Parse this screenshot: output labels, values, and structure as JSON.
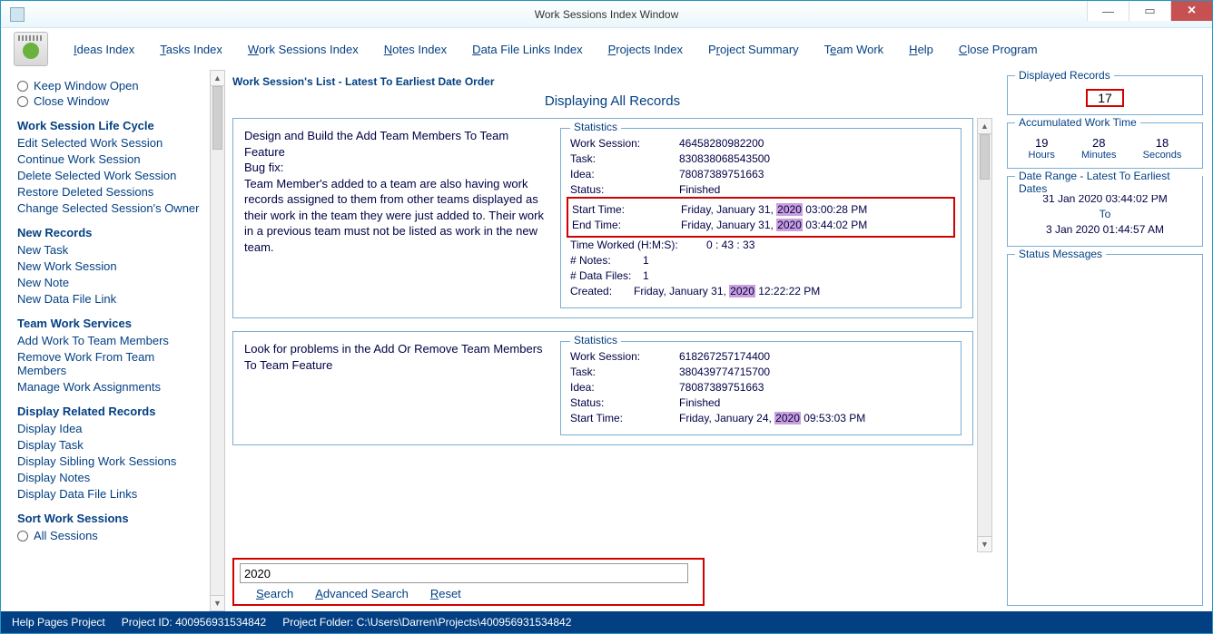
{
  "window": {
    "title": "Work Sessions Index Window"
  },
  "menu": {
    "ideas": "Ideas Index",
    "tasks": "Tasks Index",
    "work": "Work Sessions Index",
    "notes": "Notes Index",
    "datafiles": "Data File Links Index",
    "projects": "Projects Index",
    "summary": "Project Summary",
    "team": "Team Work",
    "help": "Help",
    "close": "Close Program"
  },
  "sidebar": {
    "keep_open": "Keep Window Open",
    "close_win": "Close Window",
    "h_lifecycle": "Work Session Life Cycle",
    "edit_sel": "Edit Selected Work Session",
    "continue": "Continue Work Session",
    "delete_sel": "Delete Selected Work Session",
    "restore": "Restore Deleted Sessions",
    "change_owner": "Change Selected Session's Owner",
    "h_new": "New Records",
    "new_task": "New Task",
    "new_ws": "New Work Session",
    "new_note": "New Note",
    "new_dfl": "New Data File Link",
    "h_team": "Team Work Services",
    "add_work": "Add Work To Team Members",
    "remove_work": "Remove Work From Team Members",
    "manage": "Manage Work Assignments",
    "h_related": "Display Related Records",
    "d_idea": "Display Idea",
    "d_task": "Display Task",
    "d_sibling": "Display Sibling Work Sessions",
    "d_notes": "Display Notes",
    "d_dfl": "Display Data File Links",
    "h_sort": "Sort Work Sessions",
    "all_sessions": "All Sessions"
  },
  "list": {
    "header": "Work Session's List - Latest To Earliest Date Order",
    "displaying": "Displaying All Records",
    "r1": {
      "desc": "Design and Build the Add Team Members To Team Feature\nBug fix:\nTeam Member's added to a team are also having work records assigned to them from other teams displayed as their work in the team they were just added to. Their work in a previous team must not be listed as work in the new team.",
      "stats_title": "Statistics",
      "ws_l": "Work Session:",
      "ws_v": "46458280982200",
      "task_l": "Task:",
      "task_v": "83083806854350​0",
      "idea_l": "Idea:",
      "idea_v": "78087389751663",
      "status_l": "Status:",
      "status_v": "Finished",
      "start_l": "Start Time:",
      "start_d": "Friday, January 31, ",
      "start_y": "2020",
      "start_t": "   03:00:28 PM",
      "end_l": "End Time:",
      "end_d": "Friday, January 31, ",
      "end_y": "2020",
      "end_t": "   03:44:02 PM",
      "tw_l": "Time Worked (H:M:S):",
      "tw_v": "0  :  43  :  33",
      "notes_l": "# Notes:",
      "notes_v": "1",
      "df_l": "# Data Files:",
      "df_v": "1",
      "created_l": "Created:",
      "created_d": "Friday, January 31, ",
      "created_y": "2020",
      "created_t": "   12:22:22 PM"
    },
    "r2": {
      "desc": "Look for problems in the Add Or Remove Team Members To Team Feature",
      "stats_title": "Statistics",
      "ws_l": "Work Session:",
      "ws_v": "618267257174400",
      "task_l": "Task:",
      "task_v": "380439774715700",
      "idea_l": "Idea:",
      "idea_v": "78087389751663",
      "status_l": "Status:",
      "status_v": "Finished",
      "start_l": "Start Time:",
      "start_d": "Friday, January 24, ",
      "start_y": "2020",
      "start_t": "   09:53:03 PM"
    }
  },
  "search": {
    "value": "2020",
    "search": "Search",
    "advanced": "Advanced Search",
    "reset": "Reset"
  },
  "right": {
    "displayed_title": "Displayed Records",
    "displayed_count": "17",
    "acc_title": "Accumulated Work Time",
    "hours_v": "19",
    "hours_l": "Hours",
    "mins_v": "28",
    "mins_l": "Minutes",
    "secs_v": "18",
    "secs_l": "Seconds",
    "dr_title": "Date Range - Latest To Earliest Dates",
    "dr_latest": "31 Jan 2020  03:44:02 PM",
    "dr_to": "To",
    "dr_earliest": "3 Jan 2020  01:44:57 AM",
    "status_title": "Status Messages"
  },
  "statusbar": {
    "help": "Help Pages Project",
    "pid": "Project ID: 400956931534842",
    "folder": "Project Folder: C:\\Users\\Darren\\Projects\\400956931534842"
  }
}
